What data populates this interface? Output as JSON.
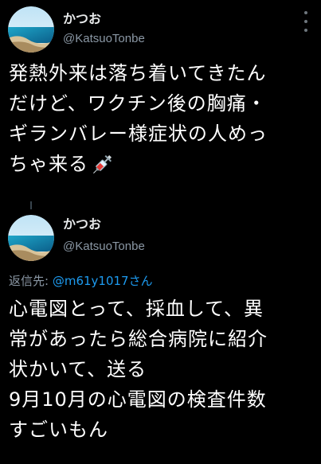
{
  "tweet1": {
    "name": "かつお",
    "handle": "@KatsuoTonbe",
    "lines": [
      "発熱外来は落ち着いてきたん",
      "だけど、ワクチン後の胸痛・",
      "ギランバレー様症状の人めっ",
      "ちゃ来る"
    ],
    "emoji": "syringe-icon"
  },
  "tweet2": {
    "name": "かつお",
    "handle": "@KatsuoTonbe",
    "reply_prefix": "返信先: ",
    "reply_mention": "@m61y1017さん",
    "lines": [
      "心電図とって、採血して、異",
      "常があったら総合病院に紹介",
      "状かいて、送る",
      "9月10月の心電図の検査件数",
      "すごいもん"
    ]
  },
  "colors": {
    "background": "#000000",
    "text": "#ffffff",
    "secondary": "#8b98a5",
    "link": "#1d9bf0"
  }
}
